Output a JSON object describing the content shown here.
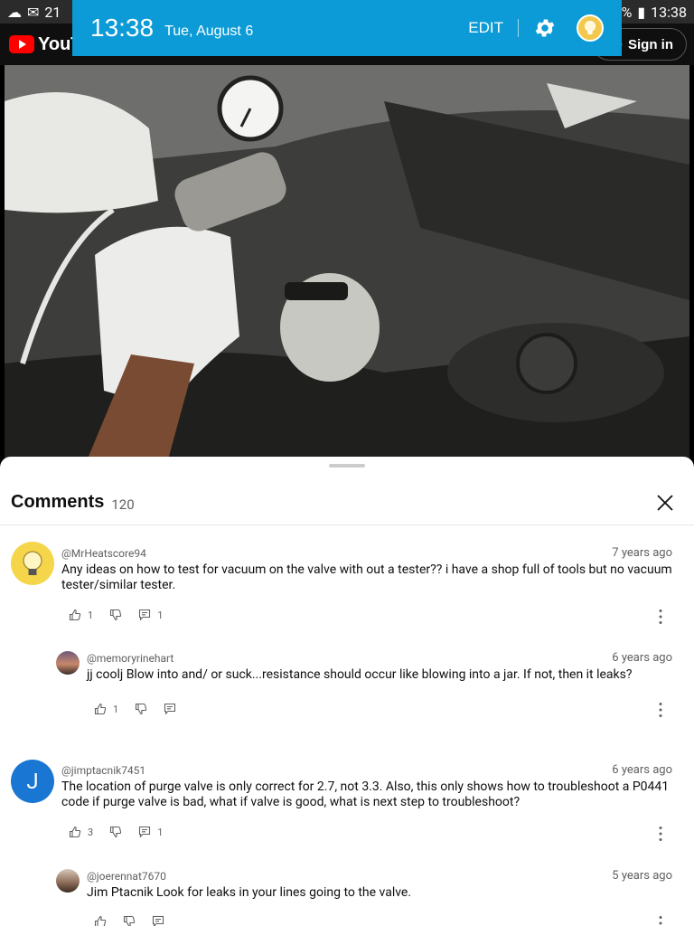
{
  "status_bar": {
    "left_text": "21",
    "battery_pct": "%",
    "time": "13:38"
  },
  "youtube": {
    "logo": "YouTube",
    "sign_in": "Sign in"
  },
  "notification": {
    "time": "13:38",
    "date": "Tue, August 6",
    "edit": "EDIT"
  },
  "comments_panel": {
    "title": "Comments",
    "count": "120",
    "comments": [
      {
        "author": "@MrHeatscore94",
        "time": "7 years ago",
        "text": "Any ideas on how to test for vacuum on the valve with out a tester?? i have a shop full of tools but no vacuum tester/similar tester.",
        "likes": "1",
        "replies": "1"
      },
      {
        "author": "@memoryrinehart",
        "time": "6 years ago",
        "text": "jj coolj Blow into and/ or suck...resistance should occur like blowing into a jar. If not, then it leaks?",
        "likes": "1",
        "replies": ""
      },
      {
        "author": "@jimptacnik7451",
        "time": "6 years ago",
        "text": "The location of purge valve is only correct for 2.7, not 3.3.  Also, this only shows how to troubleshoot a P0441 code if purge valve is bad, what if valve is good, what is next step to troubleshoot?",
        "likes": "3",
        "replies": "1",
        "initial": "J"
      },
      {
        "author": "@joerennat7670",
        "time": "5 years ago",
        "text": "Jim Ptacnik Look for leaks in your lines going to the valve.",
        "likes": "",
        "replies": ""
      }
    ]
  },
  "colors": {
    "notif_bg": "#0c9bd6",
    "avatar_blue": "#1976d2",
    "yt_red": "#ff0000"
  }
}
